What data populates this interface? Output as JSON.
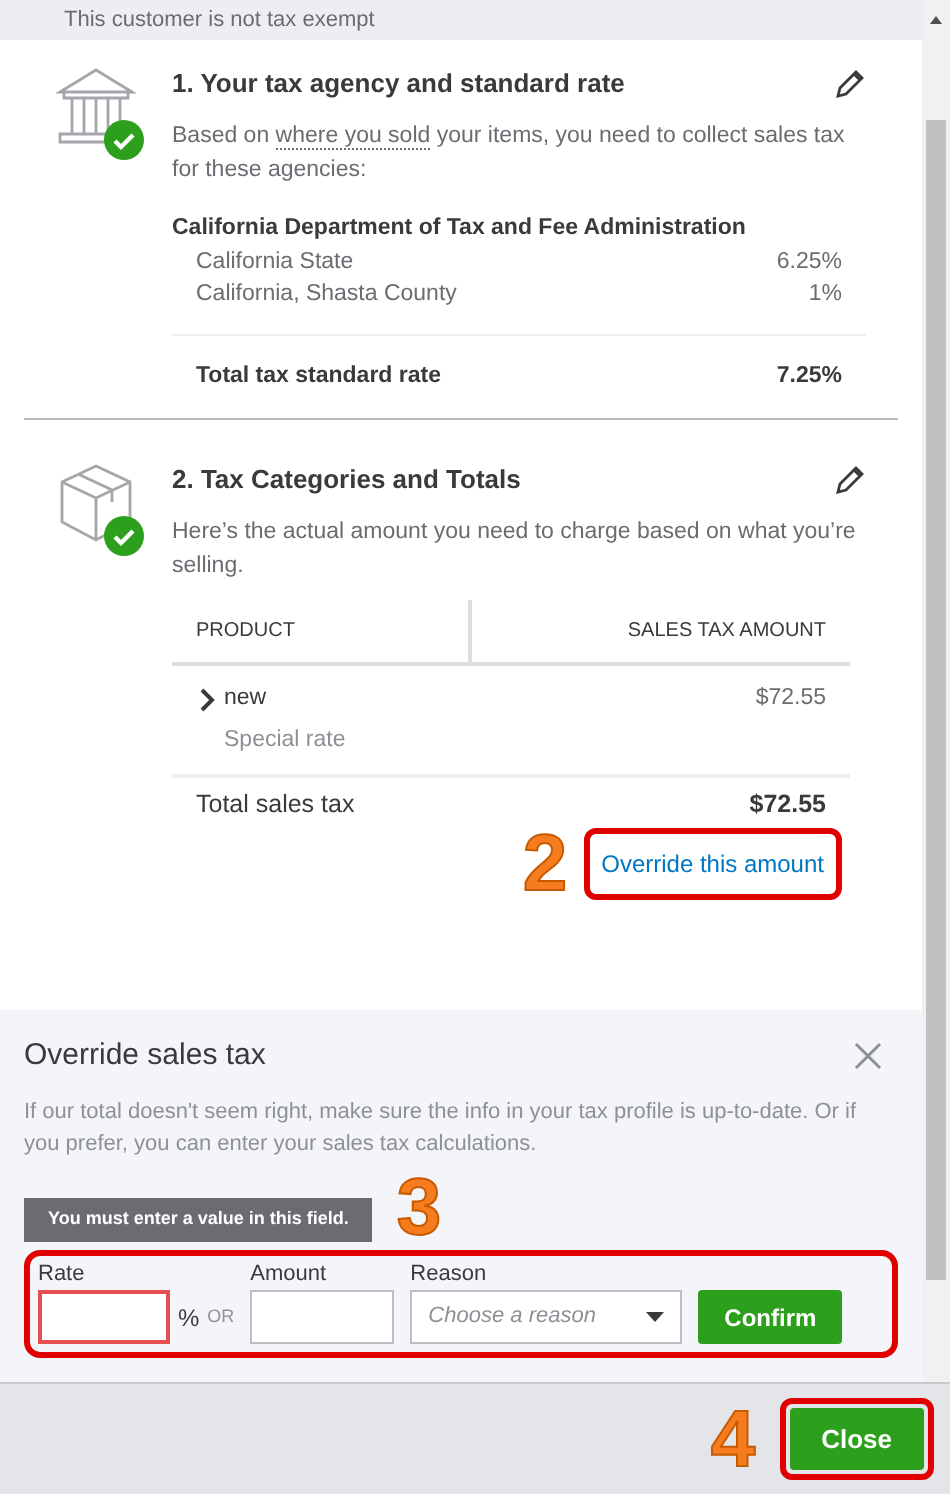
{
  "header_note": "This customer is not tax exempt",
  "agency_section": {
    "title": "1. Your tax agency and standard rate",
    "description_before": "Based on ",
    "description_link": "where you sold",
    "description_after": " your items, you need to collect sales tax for these agencies:",
    "agency": "California Department of Tax and Fee Administration",
    "rates": [
      {
        "name": "California State",
        "rate": "6.25%"
      },
      {
        "name": "California, Shasta County",
        "rate": "1%"
      }
    ],
    "total_label": "Total tax standard rate",
    "total_value": "7.25%"
  },
  "category_section": {
    "title": "2. Tax Categories and Totals",
    "description": "Here’s the actual amount you need to charge based on what you’re selling.",
    "columns": [
      "PRODUCT",
      "SALES TAX AMOUNT"
    ],
    "rows": [
      {
        "product": "new",
        "note": "Special rate",
        "amount": "$72.55",
        "expanded": false
      }
    ],
    "total_label": "Total sales tax",
    "total_value": "$72.55",
    "override_link": "Override this amount"
  },
  "override": {
    "title": "Override sales tax",
    "description": "If our total doesn't seem right, make sure the info in your tax profile is up-to-date. Or if you prefer, you can enter your sales tax calculations.",
    "tooltip": "You must enter a value in this field.",
    "rate_label": "Rate",
    "rate_error": true,
    "percent": "%",
    "or": "OR",
    "amount_label": "Amount",
    "reason_label": "Reason",
    "reason_placeholder": "Choose a reason",
    "confirm": "Confirm"
  },
  "annotations": [
    "2",
    "3",
    "4"
  ],
  "footer": {
    "close": "Close"
  }
}
